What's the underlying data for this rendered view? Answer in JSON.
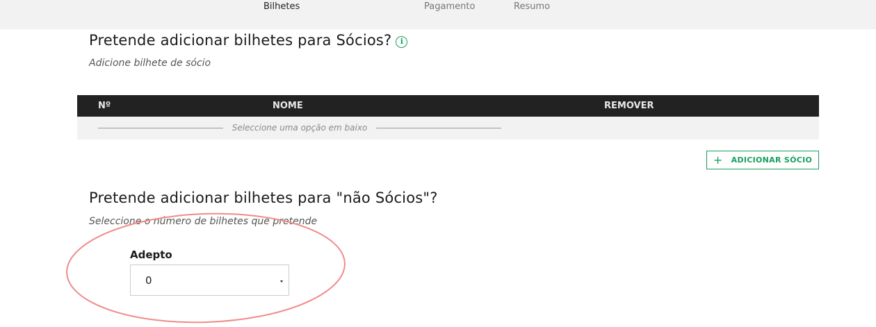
{
  "steps": [
    {
      "label": "Bilhetes",
      "active": true
    },
    {
      "label": "Pagamento",
      "active": false
    },
    {
      "label": "Resumo",
      "active": false
    }
  ],
  "socios": {
    "title": "Pretende adicionar bilhetes para Sócios?",
    "info_icon": "info-icon",
    "subtitle": "Adicione bilhete de sócio",
    "table": {
      "columns": [
        "Nº",
        "NOME",
        "REMOVER"
      ],
      "empty_message": "Seleccione uma opção em baixo"
    },
    "add_button": {
      "icon": "plus-icon",
      "label": "ADICIONAR SÓCIO"
    }
  },
  "nao_socios": {
    "title": "Pretende adicionar bilhetes para \"não Sócios\"?",
    "subtitle": "Seleccione o número de bilhetes que pretende",
    "adepto": {
      "label": "Adepto",
      "value": "0"
    }
  },
  "colors": {
    "accent": "#15a05a",
    "table_header": "#222222",
    "step_bar": "#f2f2f2",
    "annotation": "#f08a8a"
  }
}
